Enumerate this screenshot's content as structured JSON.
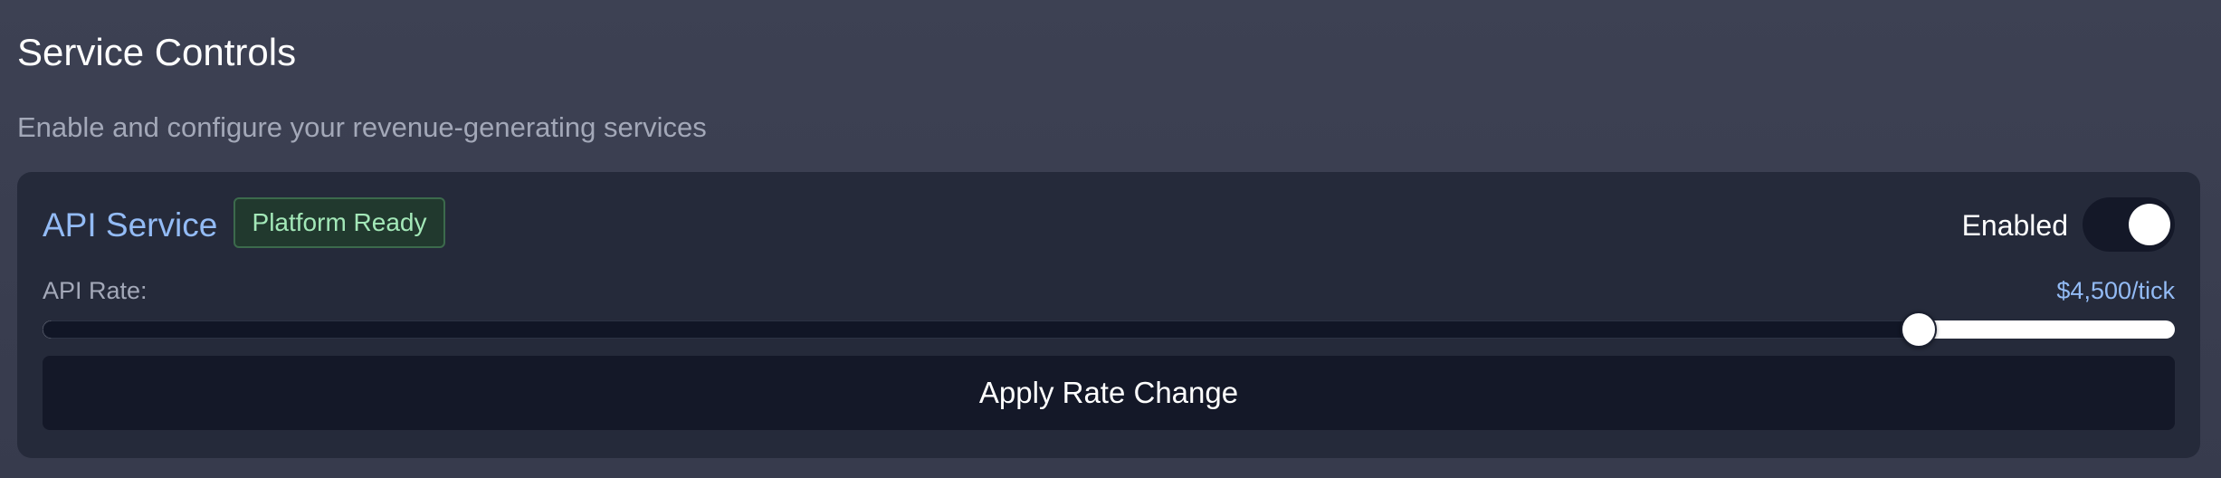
{
  "page": {
    "title": "Service Controls",
    "subtitle": "Enable and configure your revenue-generating services"
  },
  "service": {
    "name": "API Service",
    "badge": "Platform Ready",
    "toggle_label": "Enabled",
    "enabled": true,
    "rate_label": "API Rate:",
    "rate_value": "$4,500/tick",
    "rate_fraction": 0.88,
    "apply_label": "Apply Rate Change"
  },
  "colors": {
    "accent": "#93bbf5",
    "badge_text": "#a3e8b8",
    "badge_bg": "#21392e",
    "card_bg": "#252a3a"
  }
}
